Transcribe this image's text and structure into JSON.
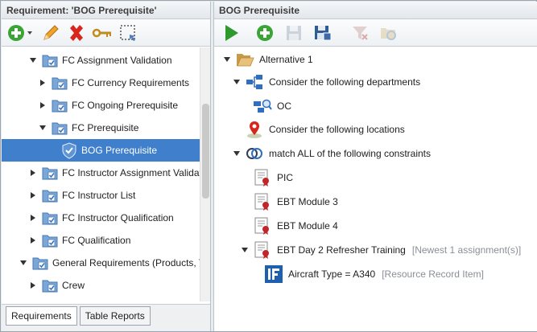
{
  "left_pane": {
    "title": "Requirement: 'BOG Prerequisite'",
    "tree": [
      {
        "label": "FC Assignment Validation",
        "expanded": true
      },
      {
        "label": "FC Currency Requirements",
        "expanded": false
      },
      {
        "label": "FC Ongoing Prerequisite",
        "expanded": false
      },
      {
        "label": "FC Prerequisite",
        "expanded": true
      },
      {
        "label": "BOG Prerequisite",
        "selected": true
      },
      {
        "label": "FC Instructor Assignment Validati",
        "expanded": false
      },
      {
        "label": "FC Instructor List",
        "expanded": false
      },
      {
        "label": "FC Instructor Qualification",
        "expanded": false
      },
      {
        "label": "FC Qualification",
        "expanded": false
      },
      {
        "label": "General Requirements (Products, T",
        "expanded": true
      },
      {
        "label": "Crew",
        "expanded": false
      }
    ],
    "tabs": [
      "Requirements",
      "Table Reports"
    ]
  },
  "right_pane": {
    "title": "BOG Prerequisite",
    "tree": [
      {
        "label": "Alternative 1",
        "icon": "folder-open-icon"
      },
      {
        "label": "Consider the following departments",
        "icon": "department-hierarchy-icon"
      },
      {
        "label": "OC",
        "icon": "department-search-icon"
      },
      {
        "label": "Consider the following locations",
        "icon": "location-pin-icon"
      },
      {
        "label": "match ALL of the following constraints",
        "icon": "linked-rings-icon"
      },
      {
        "label": "PIC",
        "icon": "certificate-icon"
      },
      {
        "label": "EBT Module 3",
        "icon": "certificate-icon"
      },
      {
        "label": "EBT Module 4",
        "icon": "certificate-icon"
      },
      {
        "label": "EBT Day 2 Refresher Training",
        "meta": "[Newest 1 assignment(s)]",
        "icon": "certificate-icon"
      },
      {
        "label": "Aircraft Type = A340",
        "meta": "[Resource Record Item]",
        "icon": "if-condition-icon"
      }
    ]
  },
  "colors": {
    "selection": "#3f7fcc",
    "add_green": "#3aa435",
    "delete_red": "#d9261c",
    "run_green": "#2e9a2e"
  }
}
